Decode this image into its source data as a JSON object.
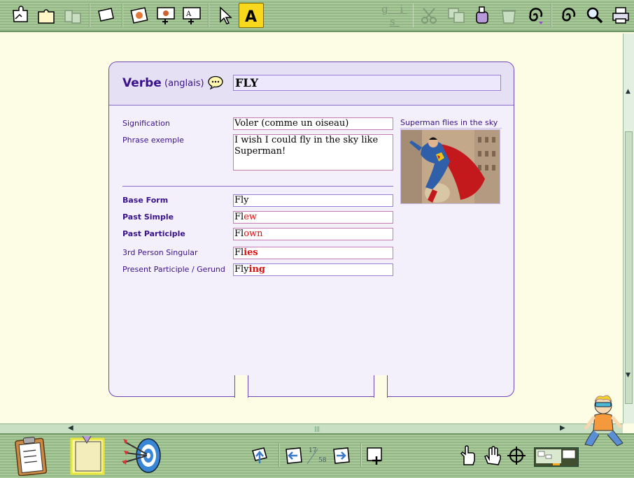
{
  "toolbar_top": {
    "gis_label": "g i s"
  },
  "card": {
    "type_label": "Verbe",
    "language_label": "(anglais)",
    "word": "FLY",
    "fields": [
      {
        "label": "Signification",
        "value": "Voler (comme un oiseau)"
      },
      {
        "label": "Phrase exemple",
        "value": "I wish I could fly in the sky like Superman!"
      }
    ],
    "image_caption": "Superman flies in the sky",
    "forms": [
      {
        "label": "Base Form",
        "stem": "Fly",
        "ending": ""
      },
      {
        "label": "Past Simple",
        "stem": "Fl",
        "ending": "ew"
      },
      {
        "label": "Past Participle",
        "stem": "Fl",
        "ending": "own"
      },
      {
        "label": "3rd Person Singular",
        "stem": "Fl",
        "ending": "ies"
      },
      {
        "label": "Present Participle / Gerund",
        "stem": "Fly",
        "ending": "ing"
      }
    ]
  },
  "pagination": {
    "current": "17",
    "total": "58"
  },
  "colors": {
    "accent": "#3a128a",
    "highlight": "#f7d81c",
    "ending_red": "#dd1111",
    "toolbar_green": "#a9c99a"
  },
  "icons": [
    "puzzle-icon",
    "open-icon",
    "merge-icon",
    "card-icon",
    "photo-icon",
    "add-image-icon",
    "add-text-icon",
    "pointer-icon",
    "text-tool-icon",
    "scissors-icon",
    "duplicate-icon",
    "glue-icon",
    "trash-icon",
    "spiral-icon",
    "search-icon",
    "print-icon"
  ]
}
